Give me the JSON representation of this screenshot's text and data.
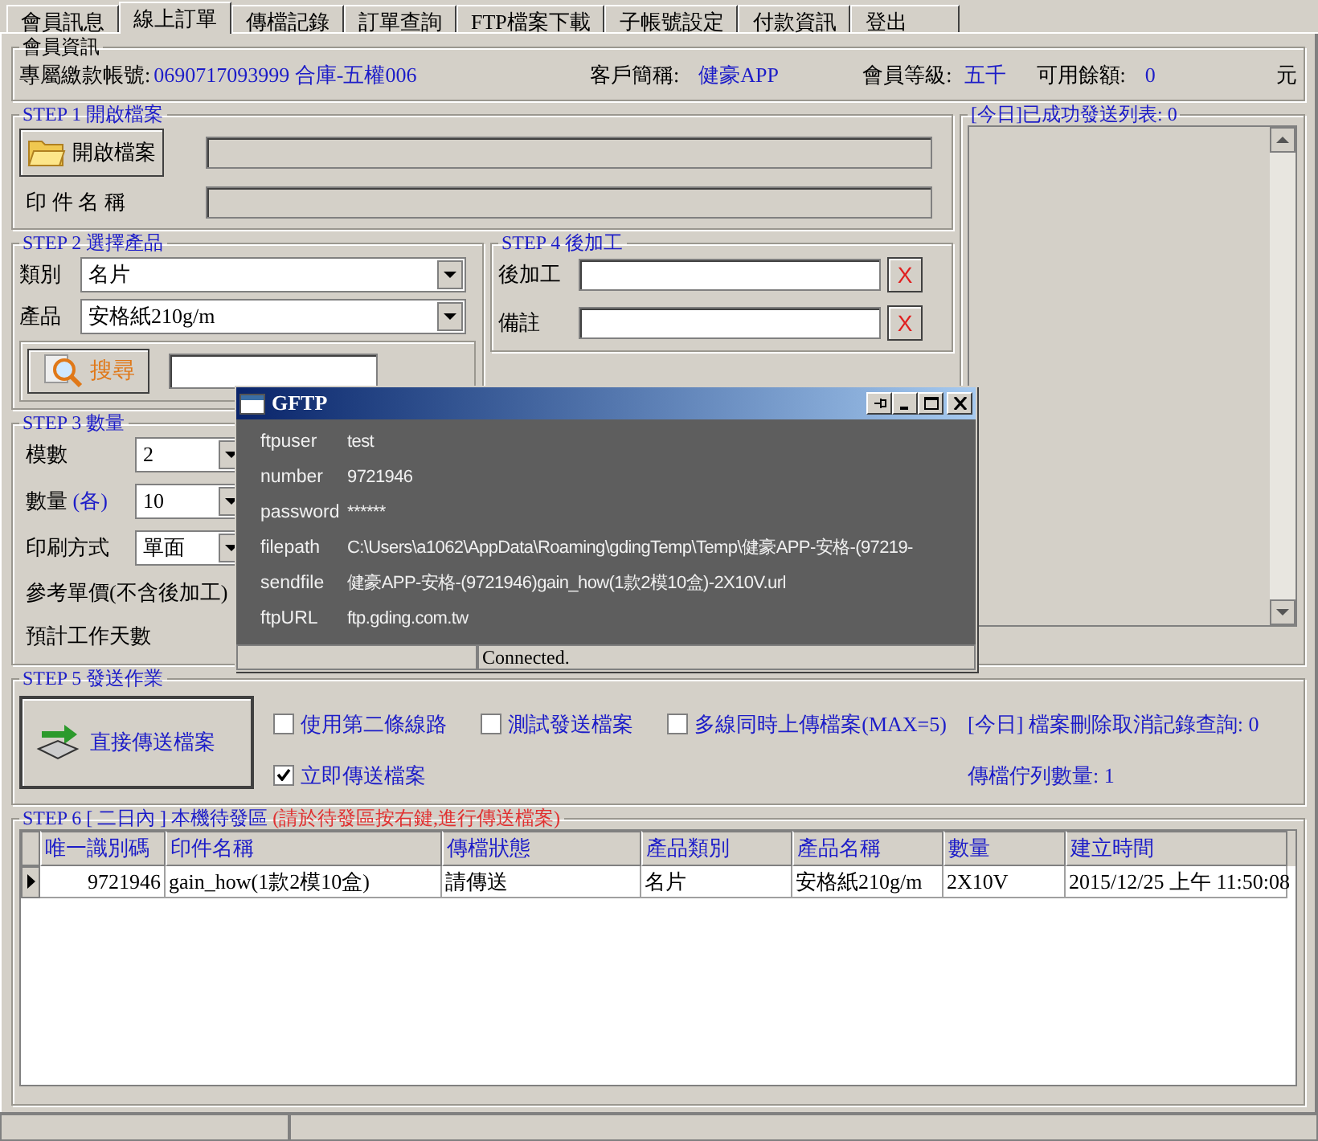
{
  "tabs": [
    {
      "label": "會員訊息",
      "selected": false
    },
    {
      "label": "線上訂單",
      "selected": true
    },
    {
      "label": "傳檔記錄",
      "selected": false
    },
    {
      "label": "訂單查詢",
      "selected": false
    },
    {
      "label": "FTP檔案下載",
      "selected": false
    },
    {
      "label": "子帳號設定",
      "selected": false
    },
    {
      "label": "付款資訊",
      "selected": false
    },
    {
      "label": "登出",
      "selected": false
    }
  ],
  "member": {
    "title": "會員資訊",
    "account_label": "專屬繳款帳號:",
    "account_value": "0690717093999 合庫-五權006",
    "name_label": "客戶簡稱:",
    "name_value": "健豪APP",
    "level_label": "會員等級:",
    "level_value": "五千",
    "balance_label": "可用餘額:",
    "balance_value": "0",
    "balance_unit": "元"
  },
  "step1": {
    "title": "STEP 1 開啟檔案",
    "open_button": "開啟檔案",
    "print_name_label": "印 件 名 稱"
  },
  "sent_list": {
    "title": "[今日]已成功發送列表: 0"
  },
  "step2": {
    "title": "STEP 2 選擇產品",
    "fields": [
      {
        "label": "類別",
        "value": "名片"
      },
      {
        "label": "產品",
        "value": "安格紙210g/m"
      }
    ],
    "search_button": "搜尋"
  },
  "step4": {
    "title": "STEP 4 後加工",
    "fields": [
      {
        "label": "後加工",
        "clear": "X"
      },
      {
        "label": "備註",
        "clear": "X"
      }
    ]
  },
  "step3": {
    "title": "STEP 3 數量",
    "fields": [
      {
        "label": "模數",
        "value": "2"
      },
      {
        "label": "數量",
        "note": "(各)",
        "value": "10"
      },
      {
        "label": "印刷方式",
        "value": "單面"
      }
    ],
    "price_label": "參考單價(不含後加工)",
    "days_label": "預計工作天數"
  },
  "step5": {
    "title": "STEP 5 發送作業",
    "send_button": "直接傳送檔案",
    "options": [
      {
        "label": "使用第二條線路",
        "checked": false
      },
      {
        "label": "測試發送檔案",
        "checked": false
      },
      {
        "label": "多線同時上傳檔案(MAX=5)",
        "checked": false
      },
      {
        "label": "立即傳送檔案",
        "checked": true
      }
    ],
    "delete_query": "[今日] 檔案刪除取消記錄查詢: 0",
    "queue": "傳檔佇列數量: 1"
  },
  "step6": {
    "title": "STEP 6 [ 二日內 ] 本機待發區",
    "note": "(請於待發區按右鍵,進行傳送檔案)",
    "columns": [
      "唯一識別碼",
      "印件名稱",
      "傳檔狀態",
      "產品類別",
      "產品名稱",
      "數量",
      "建立時間"
    ],
    "rows": [
      {
        "selected": true,
        "cells": [
          "9721946",
          "gain_how(1款2模10盒)",
          "請傳送",
          "名片",
          "安格紙210g/m",
          "2X10V",
          "2015/12/25 上午 11:50:08"
        ]
      }
    ]
  },
  "dialog": {
    "title": "GFTP",
    "fields": [
      {
        "key": "ftpuser",
        "value": "test"
      },
      {
        "key": "number",
        "value": "9721946"
      },
      {
        "key": "password",
        "value": "******"
      },
      {
        "key": "filepath",
        "value": "C:\\Users\\a1062\\AppData\\Roaming\\gdingTemp\\Temp\\健豪APP-安格-(97219-"
      },
      {
        "key": "sendfile",
        "value": "健豪APP-安格-(9721946)gain_how(1款2模10盒)-2X10V.url"
      },
      {
        "key": "ftpURL",
        "value": "ftp.gding.com.tw"
      }
    ],
    "status": "Connected."
  }
}
